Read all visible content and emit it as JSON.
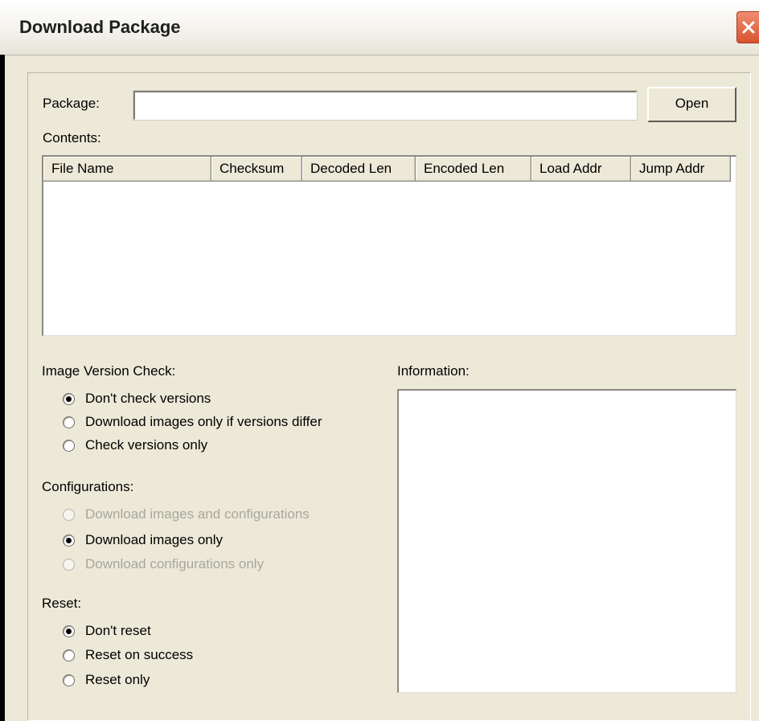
{
  "window": {
    "title": "Download Package"
  },
  "package": {
    "label": "Package:",
    "value": "",
    "open_label": "Open"
  },
  "contents": {
    "label": "Contents:",
    "columns": [
      "File Name",
      "Checksum",
      "Decoded Len",
      "Encoded Len",
      "Load Addr",
      "Jump Addr"
    ]
  },
  "image_version_check": {
    "label": "Image Version Check:",
    "options": [
      {
        "label": "Don't check versions",
        "checked": true,
        "enabled": true
      },
      {
        "label": "Download images only if versions differ",
        "checked": false,
        "enabled": true
      },
      {
        "label": "Check versions only",
        "checked": false,
        "enabled": true
      }
    ]
  },
  "configurations": {
    "label": "Configurations:",
    "options": [
      {
        "label": "Download images and configurations",
        "checked": false,
        "enabled": false
      },
      {
        "label": "Download images only",
        "checked": true,
        "enabled": true
      },
      {
        "label": "Download configurations only",
        "checked": false,
        "enabled": false
      }
    ]
  },
  "reset": {
    "label": "Reset:",
    "options": [
      {
        "label": "Don't reset",
        "checked": true,
        "enabled": true
      },
      {
        "label": "Reset on success",
        "checked": false,
        "enabled": true
      },
      {
        "label": "Reset only",
        "checked": false,
        "enabled": true
      }
    ]
  },
  "information": {
    "label": "Information:",
    "text": ""
  }
}
